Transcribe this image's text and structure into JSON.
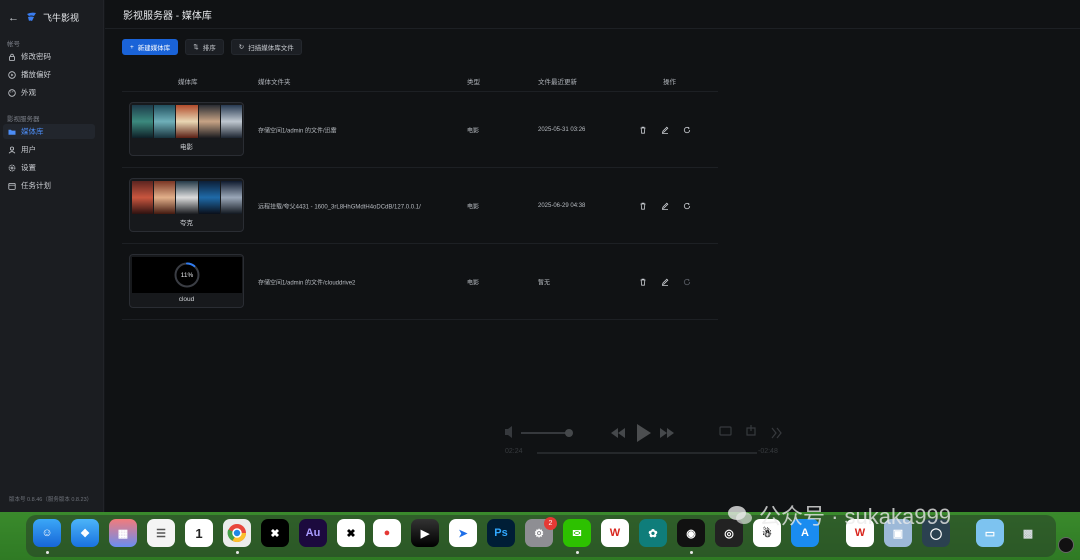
{
  "sidebar": {
    "brand": "飞牛影视",
    "section_account": "帐号",
    "section_server": "影视服务器",
    "items": [
      {
        "label": "修改密码",
        "icon": "lock-icon"
      },
      {
        "label": "播放偏好",
        "icon": "play-circle-icon"
      },
      {
        "label": "外观",
        "icon": "palette-icon"
      },
      {
        "label": "媒体库",
        "icon": "folder-icon",
        "active": true
      },
      {
        "label": "用户",
        "icon": "user-icon"
      },
      {
        "label": "设置",
        "icon": "gear-icon"
      },
      {
        "label": "任务计划",
        "icon": "calendar-icon"
      }
    ],
    "version": "版本号 0.8.46（服务版本 0.8.23）"
  },
  "header": {
    "title": "影视服务器 - 媒体库"
  },
  "toolbar": {
    "new_label": "新建媒体库",
    "sort_label": "排序",
    "scan_label": "扫描媒体库文件"
  },
  "table": {
    "headers": {
      "library": "媒体库",
      "folder": "媒体文件夹",
      "type": "类型",
      "updated": "文件最近更新",
      "actions": "操作"
    },
    "rows": [
      {
        "name": "电影",
        "folder": "存储空间1/admin 的文件/迅雷",
        "type": "电影",
        "updated": "2025-05-31 03:26"
      },
      {
        "name": "夸克",
        "folder": "远程挂载/夸父4431 - 1600_3rL8HhGMdtH4oDCdB/127.0.0.1/",
        "type": "电影",
        "updated": "2025-06-29 04:38"
      },
      {
        "name": "cloud",
        "folder": "存储空间1/admin 的文件/clouddrive2",
        "type": "电影",
        "updated": "暂无",
        "progress": "11%",
        "progress_value": 11
      }
    ]
  },
  "player": {
    "time_elapsed": "02:24",
    "time_remaining": "-02:48"
  },
  "dock": {
    "badge_count": "2",
    "capture_label": ""
  },
  "watermark": {
    "text": "公众号 · sukaka999"
  },
  "colors": {
    "accent": "#1a63d8",
    "active_nav": "#4c8df6",
    "dock_green": "#3a8a2c"
  }
}
